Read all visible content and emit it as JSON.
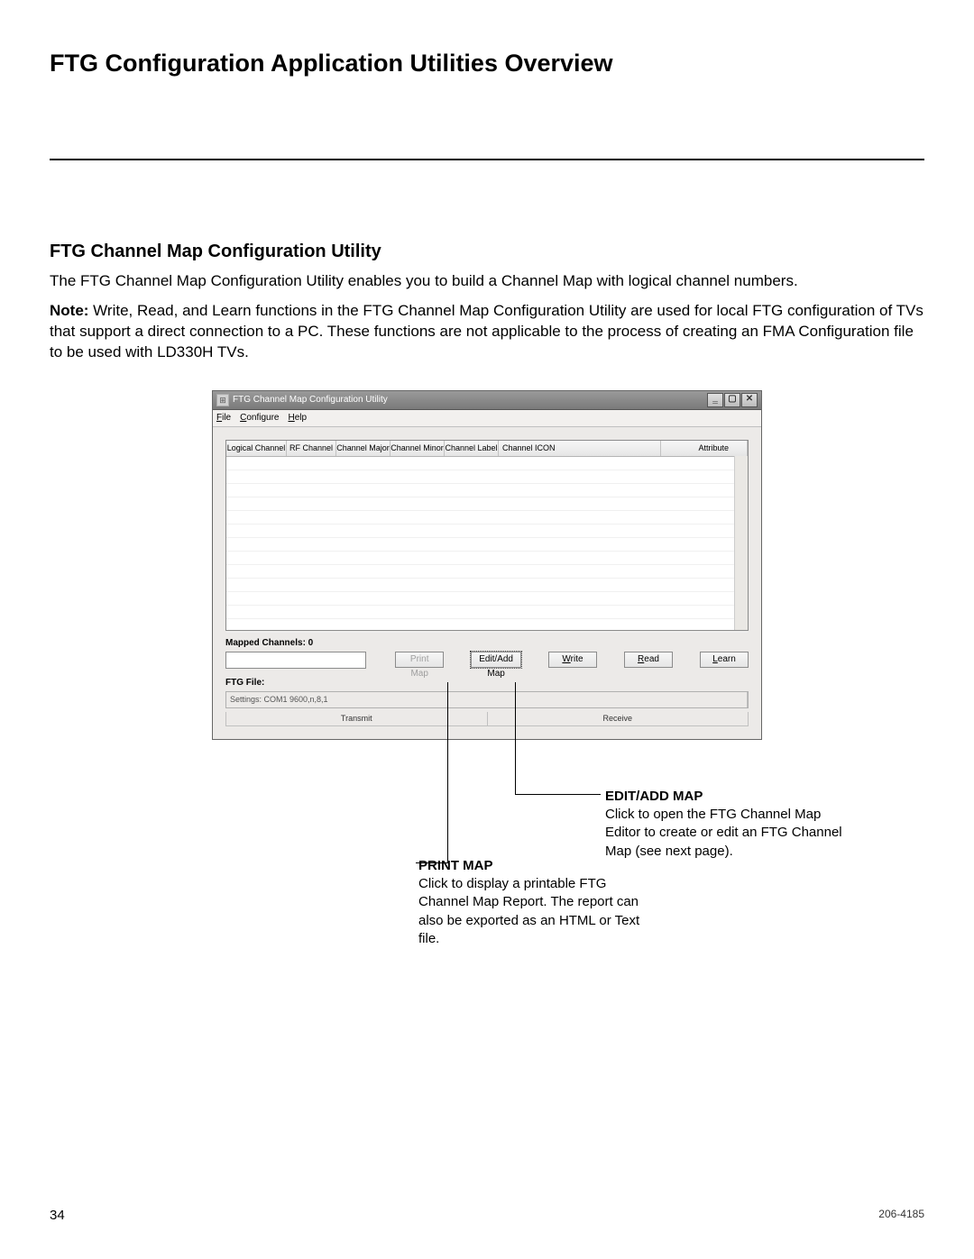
{
  "page": {
    "title": "FTG Configuration Application Utilities Overview",
    "section": "FTG Channel Map Configuration Utility",
    "intro": "The FTG Channel Map Configuration Utility enables you to build a Channel Map with logical channel numbers.",
    "note_label": "Note:",
    "note": " Write, Read, and Learn functions in the FTG Channel Map Configuration Utility are used for local FTG configuration of TVs that support a direct connection to a PC. These functions are not applicable to the process of creating an FMA Configuration file to be used with LD330H TVs.",
    "page_number": "34",
    "doc_number": "206-4185"
  },
  "app": {
    "window_title": "FTG Channel Map Configuration Utility",
    "menu": {
      "file": "File",
      "configure": "Configure",
      "help": "Help"
    },
    "columns": {
      "logical": "Logical Channel",
      "rf": "RF Channel",
      "major": "Channel Major",
      "minor": "Channel Minor",
      "label": "Channel Label",
      "icon": "Channel ICON",
      "attribute": "Attribute"
    },
    "mapped_label": "Mapped Channels: 0",
    "buttons": {
      "print": "Print Map",
      "edit": "Edit/Add Map",
      "write": "Write",
      "read": "Read",
      "learn": "Learn"
    },
    "ftg_file_label": "FTG File:",
    "status": "Settings: COM1 9600,n,8,1",
    "progress": {
      "transmit": "Transmit",
      "receive": "Receive"
    }
  },
  "callouts": {
    "edit": {
      "heading": "EDIT/ADD MAP",
      "body": "Click to open the FTG Channel Map Editor to create or edit an FTG Channel Map (see next page)."
    },
    "print": {
      "heading": "PRINT MAP",
      "body": "Click to display a printable FTG Channel Map Report. The report can also be exported as an HTML or Text file."
    }
  }
}
